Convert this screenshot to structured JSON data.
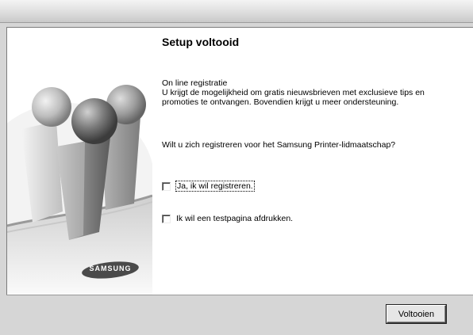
{
  "dialog": {
    "title": "Setup voltooid",
    "info_lines": [
      "On line registratie",
      "U krijgt de mogelijkheid om gratis nieuwsbrieven met exclusieve tips en",
      "promoties te ontvangen. Bovendien krijgt u meer ondersteuning."
    ],
    "question": "Wilt u zich registreren voor het Samsung Printer-lidmaatschap?",
    "options": [
      {
        "label": "Ja, ik wil registreren.",
        "checked": false,
        "focused": true
      },
      {
        "label": "Ik wil een testpagina afdrukken.",
        "checked": false,
        "focused": false
      }
    ],
    "finish_label": "Voltooien"
  },
  "branding": {
    "logo_text": "SAMSUNG",
    "logo_color": "#4a4a4a"
  },
  "colors": {
    "window_bg": "#d6d6d6",
    "panel_bg": "#ffffff",
    "text": "#000000"
  }
}
